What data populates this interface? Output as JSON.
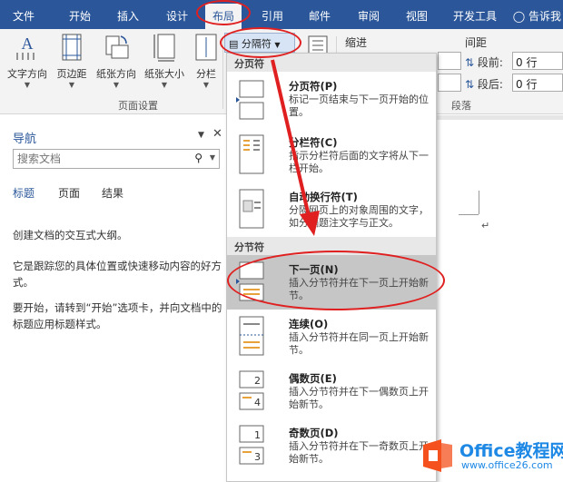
{
  "ribbon_tabs": [
    "文件",
    "开始",
    "插入",
    "设计",
    "布局",
    "引用",
    "邮件",
    "审阅",
    "视图",
    "开发工具"
  ],
  "active_tab": "布局",
  "tell_me": "告诉我",
  "page_setup": {
    "buttons": [
      "文字方向",
      "页边距",
      "纸张方向",
      "纸张大小",
      "分栏"
    ],
    "group_label": "页面设置"
  },
  "breaks_button": "分隔符",
  "paragraph": {
    "indent_label": "缩进",
    "spacing_label": "间距",
    "before_label": "段前:",
    "after_label": "段后:",
    "before_value": "0 行",
    "after_value": "0 行",
    "group_label": "段落"
  },
  "nav_pane": {
    "title": "导航",
    "search_placeholder": "搜索文档",
    "tabs": [
      "标题",
      "页面",
      "结果"
    ],
    "texts": [
      "创建文档的交互式大纲。",
      "它是跟踪您的具体位置或快速移动内容的好方式。",
      "要开始，请转到“开始”选项卡，并向文档中的标题应用标题样式。"
    ]
  },
  "breaks_menu": {
    "page_breaks_header": "分页符",
    "section_breaks_header": "分节符",
    "items": [
      {
        "title": "分页符(P)",
        "desc": "标记一页结束与下一页开始的位置。"
      },
      {
        "title": "分栏符(C)",
        "desc": "指示分栏符后面的文字将从下一栏开始。"
      },
      {
        "title": "自动换行符(T)",
        "desc": "分隔网页上的对象周围的文字，如分隔题注文字与正文。"
      },
      {
        "title": "下一页(N)",
        "desc": "插入分节符并在下一页上开始新节。"
      },
      {
        "title": "连续(O)",
        "desc": "插入分节符并在同一页上开始新节。"
      },
      {
        "title": "偶数页(E)",
        "desc": "插入分节符并在下一偶数页上开始新节。"
      },
      {
        "title": "奇数页(D)",
        "desc": "插入分节符并在下一奇数页上开始新节。"
      }
    ]
  },
  "watermark": {
    "name": "Office教程网",
    "url": "www.office26.com"
  },
  "colors": {
    "ribbon_blue": "#2b579a",
    "annotation_red": "#e02020",
    "watermark_blue": "#1e88e5",
    "watermark_orange": "#f4511e"
  }
}
